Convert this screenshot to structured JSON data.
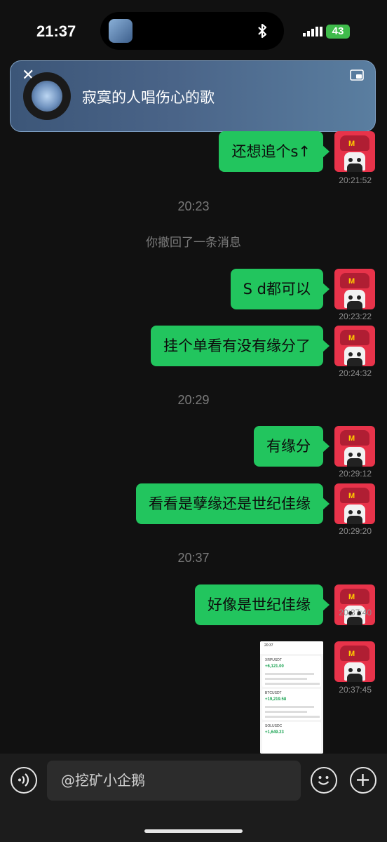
{
  "status": {
    "time": "21:37",
    "battery": "43"
  },
  "banner": {
    "song_title": "寂寞的人唱伤心的歌"
  },
  "messages": [
    {
      "text": "还想追个s↑",
      "time": "20:21:52"
    },
    {
      "text": "S d都可以",
      "time": "20:23:22"
    },
    {
      "text": "挂个单看有没有缘分了",
      "time": "20:24:32"
    },
    {
      "text": "有缘分",
      "time": "20:29:12"
    },
    {
      "text": "看看是孽缘还是世纪佳缘",
      "time": "20:29:20"
    },
    {
      "text": "好像是世纪佳缘",
      "time": "20:37:40"
    },
    {
      "text": "",
      "time": "20:37:45"
    }
  ],
  "dividers": [
    "20:23",
    "20:29",
    "20:37"
  ],
  "notice": "你撤回了一条消息",
  "screenshot": {
    "clock": "20:37",
    "pair1": "XRPUSDT",
    "pnl1": "+6,121.00",
    "pair2": "BTCUSDT",
    "pnl2": "+19,219.58",
    "pair3": "SOLUSDC",
    "pnl3": "+1,649.23"
  },
  "input": {
    "placeholder": "@挖矿小企鹅"
  },
  "colors": {
    "bubble": "#22c55e",
    "avatar": "#e8334a",
    "background": "#111111"
  }
}
